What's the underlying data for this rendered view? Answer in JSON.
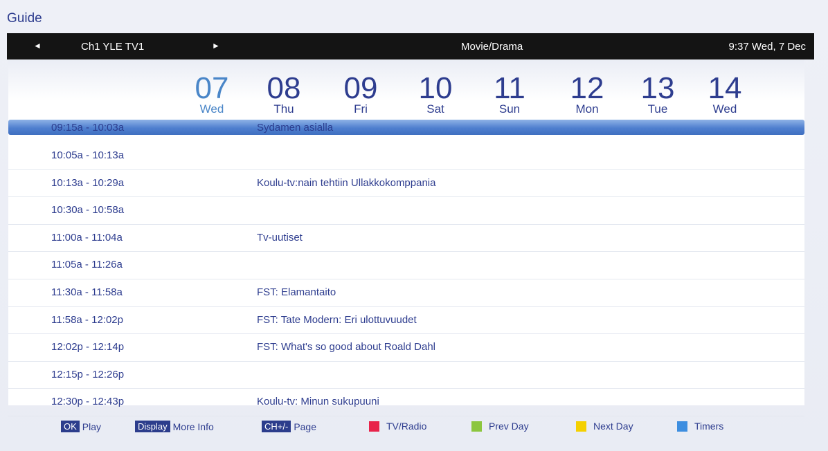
{
  "title": "Guide",
  "channel_bar": {
    "left_arrow": "◄",
    "channel": "Ch1 YLE TV1",
    "right_arrow": "►",
    "genre": "Movie/Drama",
    "clock": "9:37 Wed, 7 Dec"
  },
  "days": [
    {
      "num": "07",
      "dow": "Wed",
      "active": true
    },
    {
      "num": "08",
      "dow": "Thu"
    },
    {
      "num": "09",
      "dow": "Fri"
    },
    {
      "num": "10",
      "dow": "Sat"
    },
    {
      "num": "11",
      "dow": "Sun"
    },
    {
      "num": "12",
      "dow": "Mon"
    },
    {
      "num": "13",
      "dow": "Tue"
    },
    {
      "num": "14",
      "dow": "Wed"
    }
  ],
  "schedule": [
    {
      "time": "09:15a - 10:03a",
      "program": "Sydamen asialla",
      "selected": true
    },
    {
      "time": "10:05a - 10:13a",
      "program": ""
    },
    {
      "time": "10:13a - 10:29a",
      "program": "Koulu-tv:nain tehtiin Ullakkokomppania"
    },
    {
      "time": "10:30a - 10:58a",
      "program": ""
    },
    {
      "time": "11:00a - 11:04a",
      "program": "Tv-uutiset"
    },
    {
      "time": "11:05a - 11:26a",
      "program": ""
    },
    {
      "time": "11:30a - 11:58a",
      "program": "FST: Elamantaito"
    },
    {
      "time": "11:58a - 12:02p",
      "program": "FST: Tate Modern: Eri ulottuvuudet"
    },
    {
      "time": "12:02p - 12:14p",
      "program": "FST: What's so good about Roald Dahl"
    },
    {
      "time": "12:15p - 12:26p",
      "program": ""
    },
    {
      "time": "12:30p - 12:43p",
      "program": "Koulu-tv: Minun sukupuuni"
    }
  ],
  "legend": {
    "ok_key": "OK",
    "ok_label": "Play",
    "display_key": "Display",
    "display_label": "More Info",
    "ch_key": "CH+/-",
    "ch_label": "Page",
    "red_label": "TV/Radio",
    "green_label": "Prev Day",
    "yellow_label": "Next Day",
    "blue_label": "Timers"
  },
  "colors": {
    "red": "#e8234a",
    "green": "#8cc63f",
    "yellow": "#f4d000",
    "blue": "#3d8ee0"
  }
}
